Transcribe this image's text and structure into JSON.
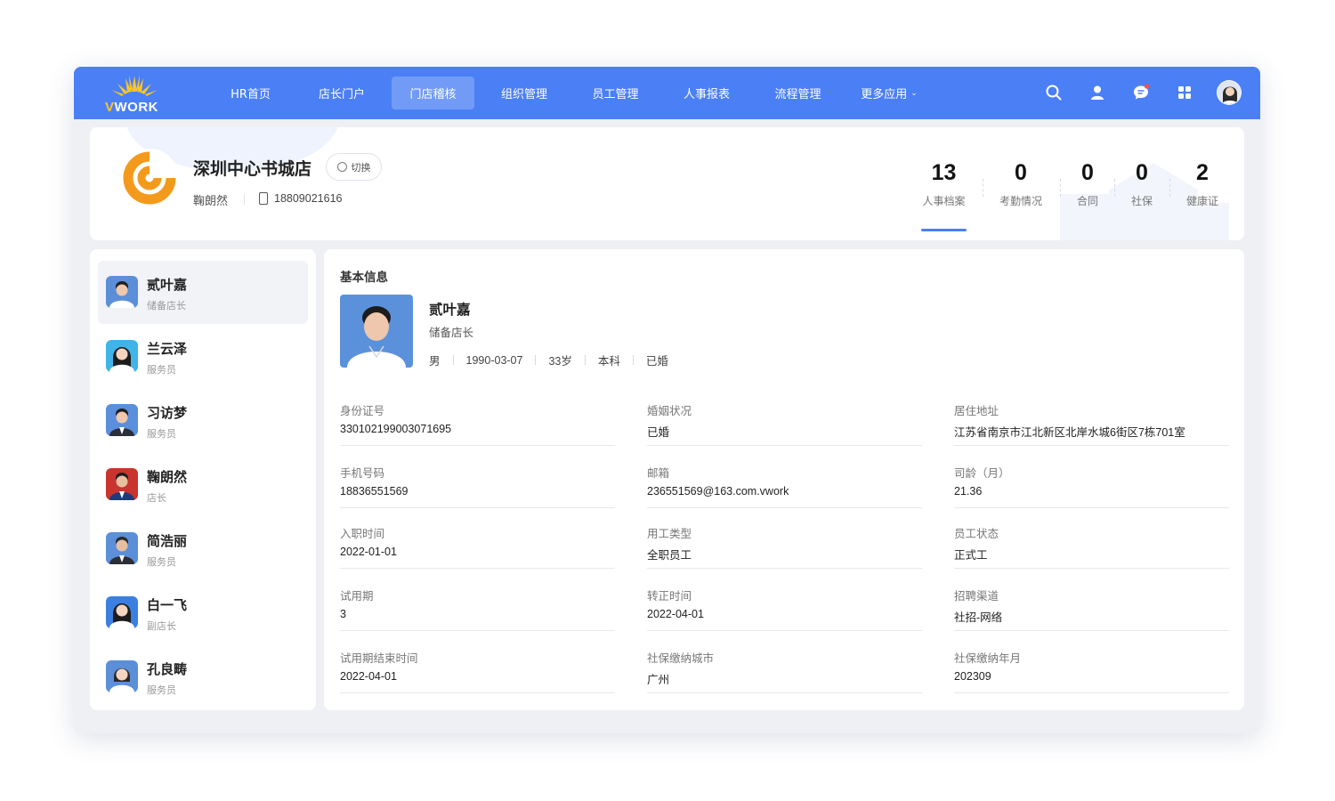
{
  "brand": {
    "logo_v": "V",
    "logo_rest": "WORK",
    "primary_color": "#4a7ff5",
    "accent_color": "#ffc526"
  },
  "nav": {
    "items": [
      {
        "label": "HR首页",
        "active": false
      },
      {
        "label": "店长门户",
        "active": false
      },
      {
        "label": "门店稽核",
        "active": true
      },
      {
        "label": "组织管理",
        "active": false
      },
      {
        "label": "员工管理",
        "active": false
      },
      {
        "label": "人事报表",
        "active": false
      },
      {
        "label": "流程管理",
        "active": false
      },
      {
        "label": "更多应用",
        "active": false
      }
    ],
    "more_caret": "⌄",
    "icons": [
      "search-icon",
      "user-icon",
      "message-icon",
      "apps-grid-icon",
      "user-avatar"
    ]
  },
  "store": {
    "name": "深圳中心书城店",
    "switch_label": "切换",
    "manager": "鞠朗然",
    "phone": "18809021616"
  },
  "stats": [
    {
      "value": "13",
      "label": "人事档案",
      "active": true
    },
    {
      "value": "0",
      "label": "考勤情况",
      "active": false
    },
    {
      "value": "0",
      "label": "合同",
      "active": false
    },
    {
      "value": "0",
      "label": "社保",
      "active": false
    },
    {
      "value": "2",
      "label": "健康证",
      "active": false
    }
  ],
  "employees": [
    {
      "name": "贰叶嘉",
      "role": "储备店长",
      "active": true
    },
    {
      "name": "兰云泽",
      "role": "服务员",
      "active": false
    },
    {
      "name": "习访梦",
      "role": "服务员",
      "active": false
    },
    {
      "name": "鞠朗然",
      "role": "店长",
      "active": false
    },
    {
      "name": "简浩丽",
      "role": "服务员",
      "active": false
    },
    {
      "name": "白一飞",
      "role": "副店长",
      "active": false
    },
    {
      "name": "孔良畴",
      "role": "服务员",
      "active": false
    }
  ],
  "detail": {
    "section_title": "基本信息",
    "profile": {
      "name": "贰叶嘉",
      "role": "储备店长",
      "meta": [
        "男",
        "1990-03-07",
        "33岁",
        "本科",
        "已婚"
      ]
    },
    "fields": [
      {
        "label": "身份证号",
        "value": "330102199003071695"
      },
      {
        "label": "婚姻状况",
        "value": "已婚"
      },
      {
        "label": "居住地址",
        "value": "江苏省南京市江北新区北岸水城6街区7栋701室"
      },
      {
        "label": "手机号码",
        "value": "18836551569"
      },
      {
        "label": "邮箱",
        "value": "236551569@163.com.vwork"
      },
      {
        "label": "司龄（月）",
        "value": "21.36"
      },
      {
        "label": "入职时间",
        "value": "2022-01-01"
      },
      {
        "label": "用工类型",
        "value": "全职员工"
      },
      {
        "label": "员工状态",
        "value": "正式工"
      },
      {
        "label": "试用期",
        "value": "3"
      },
      {
        "label": "转正时间",
        "value": "2022-04-01"
      },
      {
        "label": "招聘渠道",
        "value": "社招-网络"
      },
      {
        "label": "试用期结束时间",
        "value": "2022-04-01"
      },
      {
        "label": "社保缴纳城市",
        "value": "广州"
      },
      {
        "label": "社保缴纳年月",
        "value": "202309"
      }
    ]
  }
}
